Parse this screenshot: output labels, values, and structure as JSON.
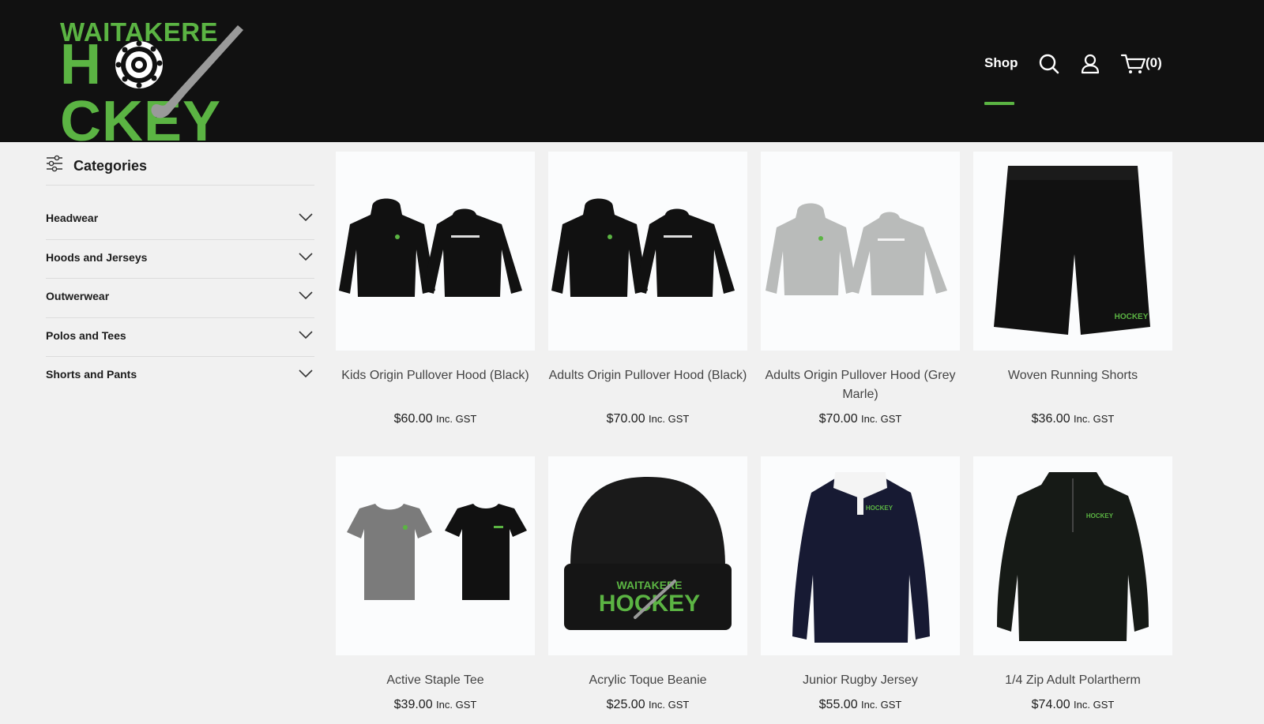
{
  "brand": {
    "top": "WAITAKERE",
    "main": "HOCKEY",
    "main_left": "H",
    "main_right": "CKEY",
    "accent": "#5bb443",
    "header_bg": "#111111"
  },
  "nav": {
    "shop_label": "Shop",
    "cart_count": "(0)",
    "icons": [
      "search-icon",
      "account-icon",
      "cart-icon"
    ]
  },
  "sidebar": {
    "title": "Categories",
    "items": [
      {
        "label": "Headwear"
      },
      {
        "label": "Hoods and Jerseys"
      },
      {
        "label": "Outwerwear"
      },
      {
        "label": "Polos and Tees"
      },
      {
        "label": "Shorts and Pants"
      }
    ]
  },
  "products": [
    {
      "name": "Kids Origin Pullover Hood (Black)",
      "price": "$60.00",
      "tax": "Inc. GST"
    },
    {
      "name": "Adults Origin Pullover Hood (Black)",
      "price": "$70.00",
      "tax": "Inc. GST"
    },
    {
      "name": "Adults Origin Pullover Hood (Grey Marle)",
      "price": "$70.00",
      "tax": "Inc. GST"
    },
    {
      "name": "Woven Running Shorts",
      "price": "$36.00",
      "tax": "Inc. GST"
    },
    {
      "name": "Active Staple Tee",
      "price": "$39.00",
      "tax": "Inc. GST"
    },
    {
      "name": "Acrylic Toque Beanie",
      "price": "$25.00",
      "tax": "Inc. GST"
    },
    {
      "name": "Junior Rugby Jersey",
      "price": "$55.00",
      "tax": "Inc. GST"
    },
    {
      "name": "1/4 Zip Adult Polartherm",
      "price": "$74.00",
      "tax": "Inc. GST"
    }
  ]
}
